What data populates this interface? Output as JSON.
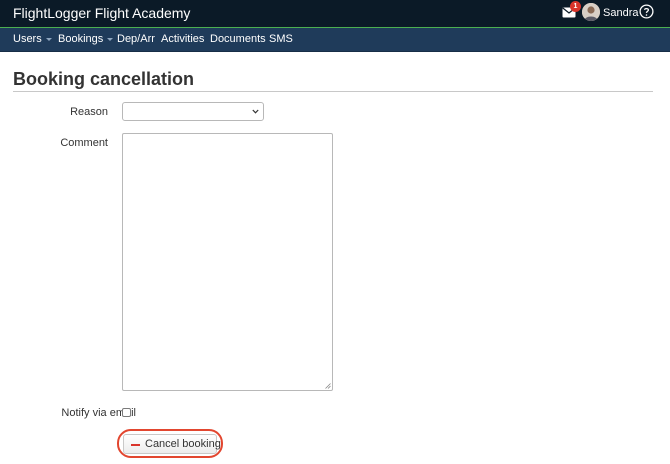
{
  "app": {
    "title": "FlightLogger Flight Academy"
  },
  "header": {
    "notification_count": "1",
    "user_name": "Sandra",
    "icons": [
      "envelope-icon",
      "avatar",
      "help-circle-icon"
    ]
  },
  "nav": {
    "items": [
      {
        "label": "Users",
        "has_dropdown": true
      },
      {
        "label": "Bookings",
        "has_dropdown": true
      },
      {
        "label": "Dep/Arr",
        "has_dropdown": false
      },
      {
        "label": "Activities",
        "has_dropdown": false
      },
      {
        "label": "Documents",
        "has_dropdown": false
      },
      {
        "label": "SMS",
        "has_dropdown": false
      }
    ]
  },
  "page": {
    "title": "Booking cancellation"
  },
  "form": {
    "reason": {
      "label": "Reason",
      "value": ""
    },
    "comment": {
      "label": "Comment",
      "value": ""
    },
    "notify": {
      "label": "Notify via email",
      "checked": false
    },
    "submit": {
      "label": "Cancel booking"
    }
  },
  "colors": {
    "topbar": "#0b1a27",
    "navbar": "#1f3b5a",
    "accent": "#4caf50",
    "badge": "#d9342b",
    "highlight": "#e2462f"
  }
}
